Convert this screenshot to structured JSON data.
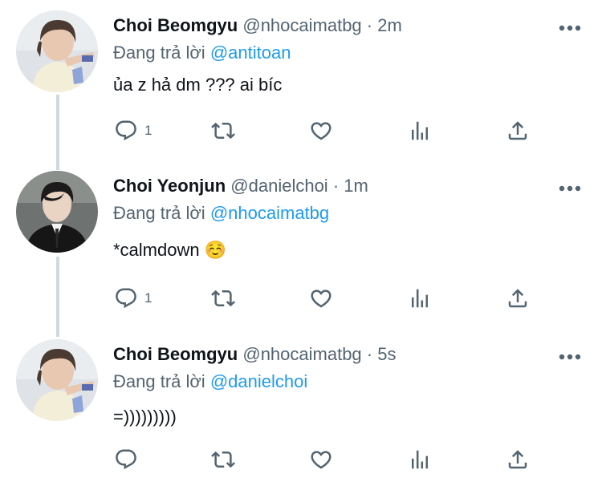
{
  "colors": {
    "text": "#0f1419",
    "secondary": "#536471",
    "mention": "#1d9bf0",
    "thread_line": "#cfd9de"
  },
  "reply_prefix": "Đang trả lời",
  "tweets": [
    {
      "name": "Choi Beomgyu",
      "handle": "@nhocaimatbg",
      "separator": "·",
      "time": "2m",
      "reply_to": "@antitoan",
      "text": "ủa z hả dm ??? ai bíc",
      "reply_count": "1",
      "avatar": "avatar-beomgyu"
    },
    {
      "name": "Choi Yeonjun",
      "handle": "@danielchoi",
      "separator": "·",
      "time": "1m",
      "reply_to": "@nhocaimatbg",
      "text": "*calmdown ☺️",
      "reply_count": "1",
      "avatar": "avatar-yeonjun"
    },
    {
      "name": "Choi Beomgyu",
      "handle": "@nhocaimatbg",
      "separator": "·",
      "time": "5s",
      "reply_to": "@danielchoi",
      "text": "=)))))))))",
      "reply_count": "",
      "avatar": "avatar-beomgyu"
    }
  ],
  "icons": [
    "more-icon",
    "reply-icon",
    "retweet-icon",
    "like-icon",
    "analytics-icon",
    "share-icon"
  ]
}
